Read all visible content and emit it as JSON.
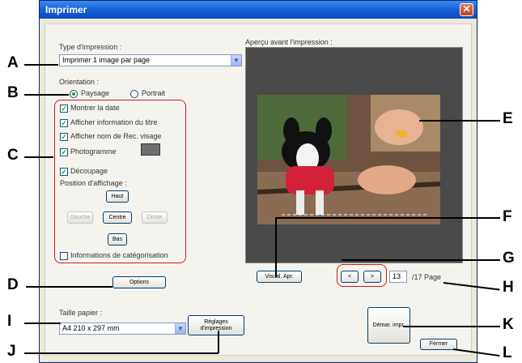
{
  "dialog": {
    "title": "Imprimer",
    "close_icon": "close-icon"
  },
  "print_type": {
    "label": "Type d'impression :",
    "value": "Imprimer 1 image par page"
  },
  "orientation": {
    "label": "Orientation :",
    "options": [
      {
        "label": "Paysage",
        "selected": true
      },
      {
        "label": "Portrait",
        "selected": false
      }
    ]
  },
  "options": {
    "show_date": {
      "label": "Montrer la date",
      "checked": true
    },
    "show_title": {
      "label": "Afficher information du titre",
      "checked": true
    },
    "show_face_name": {
      "label": "Afficher nom de Rec. visage",
      "checked": true
    },
    "frame": {
      "label": "Photogramme",
      "checked": true
    },
    "crop": {
      "label": "Découpage",
      "checked": true
    },
    "category_info": {
      "label": "Informations de catégorisation",
      "checked": false
    }
  },
  "position": {
    "label": "Position d'affichage :",
    "top": "Haut",
    "left": "Gauche",
    "center": "Centre",
    "right": "Droite",
    "bottom": "Bas"
  },
  "options_button": "Options",
  "preview": {
    "label": "Aperçu avant l'impression :",
    "print_preview_button": "Visual. Apr.",
    "prev_button": "<",
    "next_button": ">",
    "page_value": "13",
    "page_total": "/17 Page"
  },
  "paper": {
    "label": "Taille papier :",
    "value": "A4 210 x 297 mm",
    "settings_button": "Réglages d'impression"
  },
  "start_print_button": "Démar. impr.",
  "close_button": "Fermer",
  "callouts": [
    "A",
    "B",
    "C",
    "D",
    "E",
    "F",
    "G",
    "H",
    "I",
    "J",
    "K",
    "L"
  ],
  "colors": {
    "titlebar": "#0b4cc2",
    "callout_frame": "#d01c1c",
    "preview_bg": "#4a4a4a"
  }
}
